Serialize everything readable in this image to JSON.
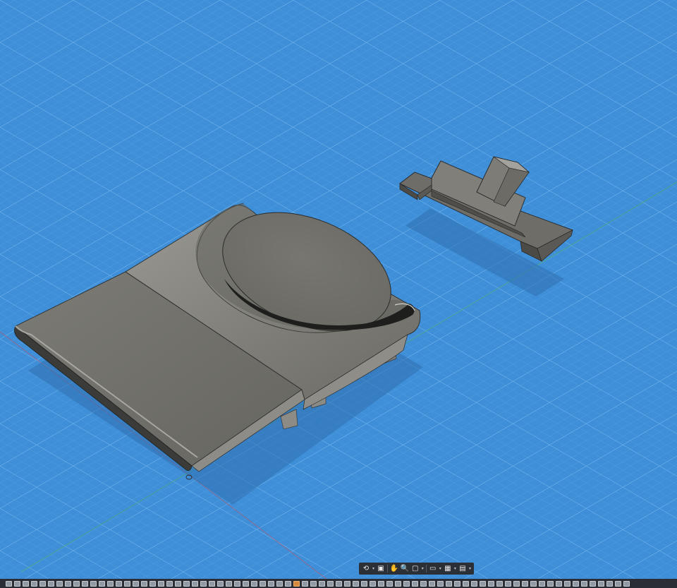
{
  "viewport": {
    "background_color": "#3f8fd8",
    "grid_color": "#6aaee8",
    "body_color": "#6f6e69"
  },
  "navigation_bar": {
    "tools": [
      {
        "name": "orbit-icon",
        "glyph": "⟲"
      },
      {
        "name": "look-at-icon",
        "glyph": "▣"
      },
      {
        "name": "pan-hand-icon",
        "glyph": "✋"
      },
      {
        "name": "zoom-icon",
        "glyph": "🔍"
      },
      {
        "name": "fit-window-icon",
        "glyph": "▢"
      },
      {
        "name": "display-settings-icon",
        "glyph": "▭"
      },
      {
        "name": "grid-settings-icon",
        "glyph": "▦"
      },
      {
        "name": "viewports-icon",
        "glyph": "▤"
      }
    ]
  },
  "timeline": {
    "feature_count": 74,
    "accent_index": 34
  }
}
